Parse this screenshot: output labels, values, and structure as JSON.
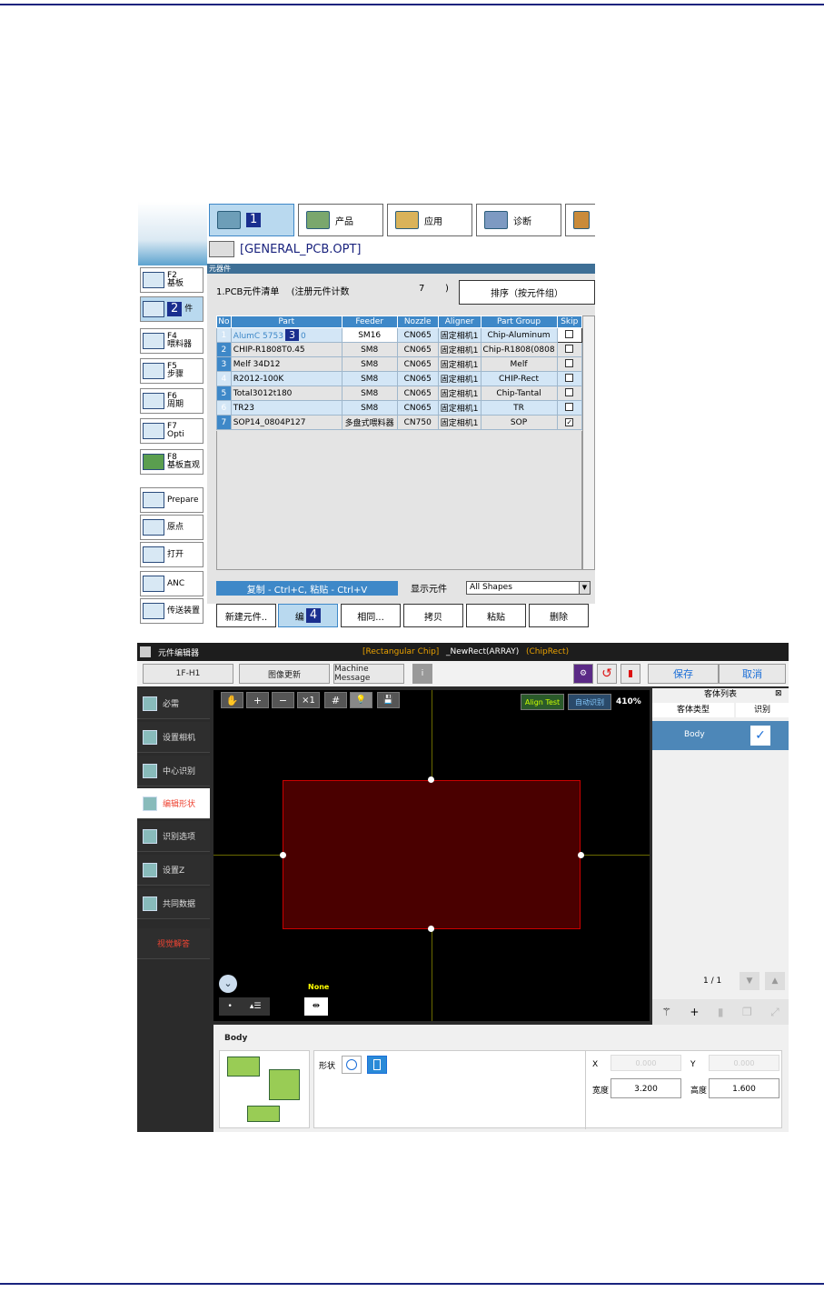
{
  "screen1": {
    "tabs": [
      {
        "label": "",
        "marker": "1"
      },
      {
        "label": "产品"
      },
      {
        "label": "应用"
      },
      {
        "label": "诊断"
      }
    ],
    "file_title": "[GENERAL_PCB.OPT]",
    "section_label": "元器件",
    "sidebar": [
      {
        "key": "F2",
        "label": "基板"
      },
      {
        "key": "",
        "label": "件",
        "marker": "2"
      },
      {
        "key": "F4",
        "label": "喂料器"
      },
      {
        "key": "F5",
        "label": "步骤"
      },
      {
        "key": "F6",
        "label": "周期"
      },
      {
        "key": "F7",
        "label": "Opti"
      },
      {
        "key": "F8",
        "label": "基板直观"
      },
      {
        "key": "",
        "label": "Prepare"
      },
      {
        "key": "",
        "label": "原点"
      },
      {
        "key": "",
        "label": "打开"
      },
      {
        "key": "",
        "label": "ANC"
      },
      {
        "key": "",
        "label": "传送装置"
      }
    ],
    "list_title": "1.PCB元件清单",
    "count_label": "(注册元件计数",
    "count_value": "7",
    "count_close": ")",
    "sort_button": "排序（按元件组）",
    "columns": [
      "No",
      "Part",
      "Feeder",
      "Nozzle",
      "Aligner",
      "Part Group",
      "Skip"
    ],
    "rows": [
      {
        "no": "1",
        "part": "AlumC 5753",
        "part_tail": "0",
        "marker": "3",
        "feeder": "SM16",
        "nozzle": "CN065",
        "aligner": "固定相机1",
        "group": "Chip-Aluminum",
        "skip": false
      },
      {
        "no": "2",
        "part": "CHIP-R1808T0.45",
        "feeder": "SM8",
        "nozzle": "CN065",
        "aligner": "固定相机1",
        "group": "Chip-R1808(0808",
        "skip": false
      },
      {
        "no": "3",
        "part": "Melf 34D12",
        "feeder": "SM8",
        "nozzle": "CN065",
        "aligner": "固定相机1",
        "group": "Melf",
        "skip": false
      },
      {
        "no": "4",
        "part": "R2012-100K",
        "feeder": "SM8",
        "nozzle": "CN065",
        "aligner": "固定相机1",
        "group": "CHIP-Rect",
        "skip": false
      },
      {
        "no": "5",
        "part": "Total3012t180",
        "feeder": "SM8",
        "nozzle": "CN065",
        "aligner": "固定相机1",
        "group": "Chip-Tantal",
        "skip": false
      },
      {
        "no": "6",
        "part": "TR23",
        "feeder": "SM8",
        "nozzle": "CN065",
        "aligner": "固定相机1",
        "group": "TR",
        "skip": false
      },
      {
        "no": "7",
        "part": "SOP14_0804P127",
        "feeder": "多盘式喂料器",
        "nozzle": "CN750",
        "aligner": "固定相机1",
        "group": "SOP",
        "skip": true
      }
    ],
    "copy_hint": "复制 - Ctrl+C, 粘贴 - Ctrl+V",
    "show_label": "显示元件",
    "show_value": "All Shapes",
    "buttons": [
      {
        "label": "新建元件.."
      },
      {
        "label": "编",
        "marker": "4"
      },
      {
        "label": "相同..."
      },
      {
        "label": "拷贝"
      },
      {
        "label": "粘贴"
      },
      {
        "label": "删除"
      }
    ]
  },
  "screen2": {
    "title": "元件编辑器",
    "part_type": "[Rectangular Chip]",
    "part_name": "_NewRect(ARRAY)",
    "part_group": "(ChipRect)",
    "head_select": "1F-H1",
    "image_update": "图像更新",
    "machine_message": "Machine Message",
    "save": "保存",
    "cancel": "取消",
    "nav": [
      "必需",
      "设置相机",
      "中心识别",
      "编辑形状",
      "识别选项",
      "设置Z",
      "共同数据"
    ],
    "nav_active": "编辑形状",
    "nav_extra": "视觉解答",
    "toolbar": [
      "✋",
      "+",
      "−",
      "×1",
      "#",
      "💡",
      "💾"
    ],
    "align_test": "Align Test",
    "auto_recognize": "自动识别",
    "zoom": "410%",
    "none_label": "None",
    "body_list": {
      "title": "客体列表",
      "col_type": "客体类型",
      "col_rec": "识别",
      "item": "Body",
      "page": "1 / 1"
    },
    "body_section": "Body",
    "shape_label": "形状",
    "x_label": "X",
    "x_value": "0.000",
    "y_label": "Y",
    "y_value": "0.000",
    "width_label": "宽度",
    "width_value": "3.200",
    "height_label": "高度",
    "height_value": "1.600"
  }
}
